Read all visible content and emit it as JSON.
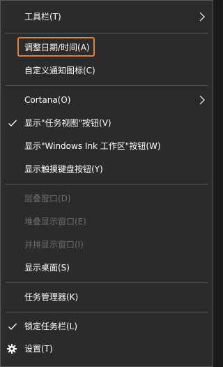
{
  "menu": {
    "toolbar": "工具栏(T)",
    "adjust_datetime": "调整日期/时间(A)",
    "customize_icons": "自定义通知图标(C)",
    "cortana": "Cortana(O)",
    "show_task_view": "显示\"任务视图\"按钮(V)",
    "show_ink_workspace": "显示\"Windows Ink 工作区\"按钮(W)",
    "show_touch_keyboard": "显示触摸键盘按钮(Y)",
    "cascade_windows": "层叠窗口(D)",
    "stack_windows": "堆叠显示窗口(E)",
    "side_by_side": "并排显示窗口(I)",
    "show_desktop": "显示桌面(S)",
    "task_manager": "任务管理器(K)",
    "lock_taskbar": "锁定任务栏(L)",
    "settings": "设置(T)"
  },
  "icons": {
    "submenu": "chevron-right-icon",
    "checked": "checkmark-icon",
    "settings": "gear-icon"
  },
  "colors": {
    "background": "#2b2b2b",
    "highlight_border": "#e8812e",
    "disabled_text": "#6d6d6d",
    "separator": "#555555"
  }
}
